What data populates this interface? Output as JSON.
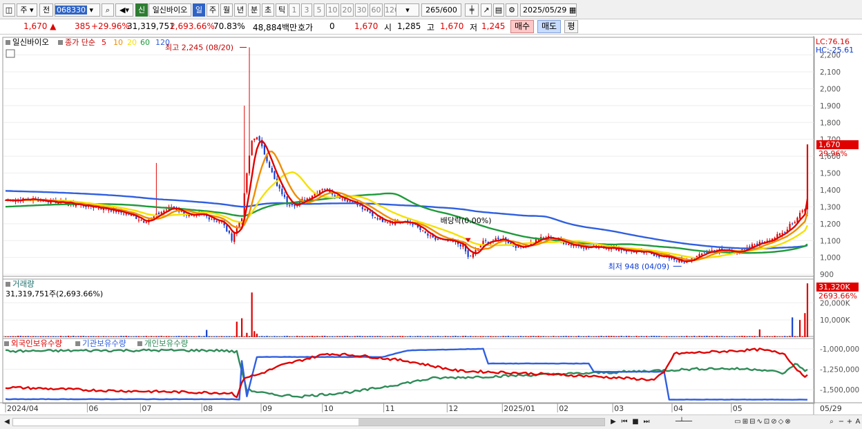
{
  "toolbar": {
    "market": "주",
    "prev_label": "전",
    "code": "068330",
    "credit": "신",
    "stock_name": "일신바이오",
    "periods": [
      "일",
      "주",
      "월",
      "년",
      "분",
      "초",
      "틱"
    ],
    "active_period": "일",
    "intervals": [
      "1",
      "3",
      "5",
      "10",
      "20",
      "30",
      "60",
      "120"
    ],
    "count": "265",
    "count_total": "/600",
    "date": "2025/05/29"
  },
  "quote": {
    "price": "1,670",
    "change": "385",
    "change_pct": "+29.96%",
    "volume": "31,319,751",
    "volume_ratio": "2,693.66%",
    "turnover": "70.83%",
    "amount": "48,884백만",
    "hoga_label": "호가",
    "hoga_value": "0",
    "hoga_price": "1,670",
    "open_label": "시",
    "open": "1,285",
    "high_label": "고",
    "high": "1,670",
    "low_label": "저",
    "low": "1,245",
    "buy_label": "매수",
    "sell_label": "매도",
    "avg_label": "평"
  },
  "colors": {
    "up": "#e00000",
    "down": "#1540d0",
    "ma5": "#e00000",
    "ma10": "#f08c00",
    "ma20": "#f5e000",
    "ma60": "#1e9a3a",
    "ma120": "#2f5fe0",
    "foreign": "#e00000",
    "institution": "#2f5fe0",
    "individual": "#2e8b57"
  },
  "chart_data": [
    {
      "type": "candlestick",
      "title": "일신바이오",
      "legend": [
        "종가 단순",
        "5",
        "10",
        "20",
        "60",
        "120"
      ],
      "lc_label": "LC:76.16",
      "hc_label": "HC:-25.61",
      "last_price_label": "1,670",
      "last_change_label": "29.96%",
      "ylim": [
        880,
        2280
      ],
      "yticks": [
        900,
        1000,
        1100,
        1200,
        1300,
        1400,
        1500,
        1600,
        1700,
        1800,
        1900,
        2000,
        2100,
        2200
      ],
      "x_labels": [
        "2024/04",
        "06",
        "07",
        "08",
        "09",
        "10",
        "11",
        "12",
        "2025/01",
        "02",
        "03",
        "04",
        "05",
        "05/29"
      ],
      "annotations": [
        {
          "text": "최고 2,245 (08/20)",
          "value": 2245
        },
        {
          "text": "최저 948 (04/09)",
          "value": 948
        },
        {
          "text": "배당락(0.00%)",
          "value": 1100
        }
      ],
      "close_keyframes": [
        [
          0,
          1340
        ],
        [
          10,
          1345
        ],
        [
          20,
          1330
        ],
        [
          30,
          1310
        ],
        [
          40,
          1290
        ],
        [
          50,
          1250
        ],
        [
          55,
          1215
        ],
        [
          58,
          1230
        ],
        [
          62,
          1270
        ],
        [
          66,
          1300
        ],
        [
          70,
          1270
        ],
        [
          74,
          1240
        ],
        [
          78,
          1255
        ],
        [
          82,
          1230
        ],
        [
          86,
          1210
        ],
        [
          90,
          1110
        ],
        [
          92,
          1180
        ],
        [
          94,
          1240
        ],
        [
          96,
          1500
        ],
        [
          98,
          1690
        ],
        [
          100,
          1720
        ],
        [
          102,
          1650
        ],
        [
          104,
          1580
        ],
        [
          106,
          1500
        ],
        [
          108,
          1420
        ],
        [
          110,
          1380
        ],
        [
          112,
          1320
        ],
        [
          114,
          1320
        ],
        [
          116,
          1310
        ],
        [
          118,
          1340
        ],
        [
          120,
          1350
        ],
        [
          122,
          1370
        ],
        [
          124,
          1390
        ],
        [
          126,
          1410
        ],
        [
          128,
          1400
        ],
        [
          130,
          1380
        ],
        [
          134,
          1350
        ],
        [
          138,
          1330
        ],
        [
          142,
          1290
        ],
        [
          146,
          1250
        ],
        [
          150,
          1220
        ],
        [
          154,
          1210
        ],
        [
          158,
          1210
        ],
        [
          162,
          1200
        ],
        [
          166,
          1150
        ],
        [
          170,
          1110
        ],
        [
          174,
          1100
        ],
        [
          178,
          1090
        ],
        [
          182,
          1070
        ],
        [
          184,
          1000
        ],
        [
          186,
          1020
        ],
        [
          190,
          1090
        ],
        [
          194,
          1100
        ],
        [
          198,
          1110
        ],
        [
          202,
          1070
        ],
        [
          205,
          1060
        ],
        [
          208,
          1080
        ],
        [
          212,
          1110
        ],
        [
          216,
          1120
        ],
        [
          220,
          1100
        ],
        [
          224,
          1080
        ],
        [
          228,
          1070
        ],
        [
          232,
          1060
        ],
        [
          236,
          1065
        ],
        [
          240,
          1060
        ],
        [
          244,
          1050
        ],
        [
          248,
          1040
        ],
        [
          252,
          1030
        ],
        [
          256,
          1025
        ],
        [
          260,
          1010
        ],
        [
          264,
          1000
        ],
        [
          268,
          980
        ],
        [
          270,
          960
        ],
        [
          272,
          990
        ],
        [
          276,
          1010
        ],
        [
          278,
          1030
        ],
        [
          282,
          1045
        ],
        [
          286,
          1040
        ],
        [
          290,
          1035
        ],
        [
          294,
          1040
        ],
        [
          298,
          1080
        ],
        [
          300,
          1085
        ],
        [
          302,
          1100
        ],
        [
          306,
          1120
        ],
        [
          310,
          1150
        ],
        [
          312,
          1200
        ],
        [
          314,
          1210
        ],
        [
          316,
          1270
        ],
        [
          318,
          1285
        ]
      ],
      "high_points": [
        [
          97,
          2245
        ],
        [
          95,
          1900
        ],
        [
          60,
          1560
        ]
      ],
      "last_candle": {
        "open": 1285,
        "high": 1670,
        "low": 1245,
        "close": 1670
      },
      "ma_start_levels": {
        "ma60": 1300,
        "ma120": 1395
      }
    },
    {
      "type": "bar",
      "title": "거래량",
      "info": "31,319,751주(2,693.66%)",
      "last_label": "31,320K",
      "last_ratio_label": "2693.66%",
      "yticks": [
        10000,
        20000
      ],
      "ytick_labels": [
        "10,000K",
        "20,000K"
      ],
      "ylim": [
        0,
        33000
      ],
      "spikes_k": [
        [
          80,
          4200
        ],
        [
          92,
          9000
        ],
        [
          94,
          11000
        ],
        [
          96,
          2500
        ],
        [
          98,
          26000
        ],
        [
          99,
          3500
        ],
        [
          100,
          2000
        ],
        [
          300,
          4500
        ],
        [
          313,
          11500
        ],
        [
          316,
          10000
        ],
        [
          318,
          14000
        ],
        [
          319,
          31320
        ]
      ],
      "base_k": 550
    },
    {
      "type": "line",
      "series": [
        {
          "name": "외국인보유수량",
          "color": "#e00000"
        },
        {
          "name": "기관보유수량",
          "color": "#2f5fe0"
        },
        {
          "name": "개인보유수량",
          "color": "#2e8b57"
        }
      ],
      "yticks": [
        -1000000,
        -1250000,
        -1500000
      ],
      "ytick_labels": [
        "-1,000,000",
        "-1,250,000",
        "-1,500,000"
      ],
      "ylim": [
        -1650000,
        -900000
      ]
    }
  ]
}
